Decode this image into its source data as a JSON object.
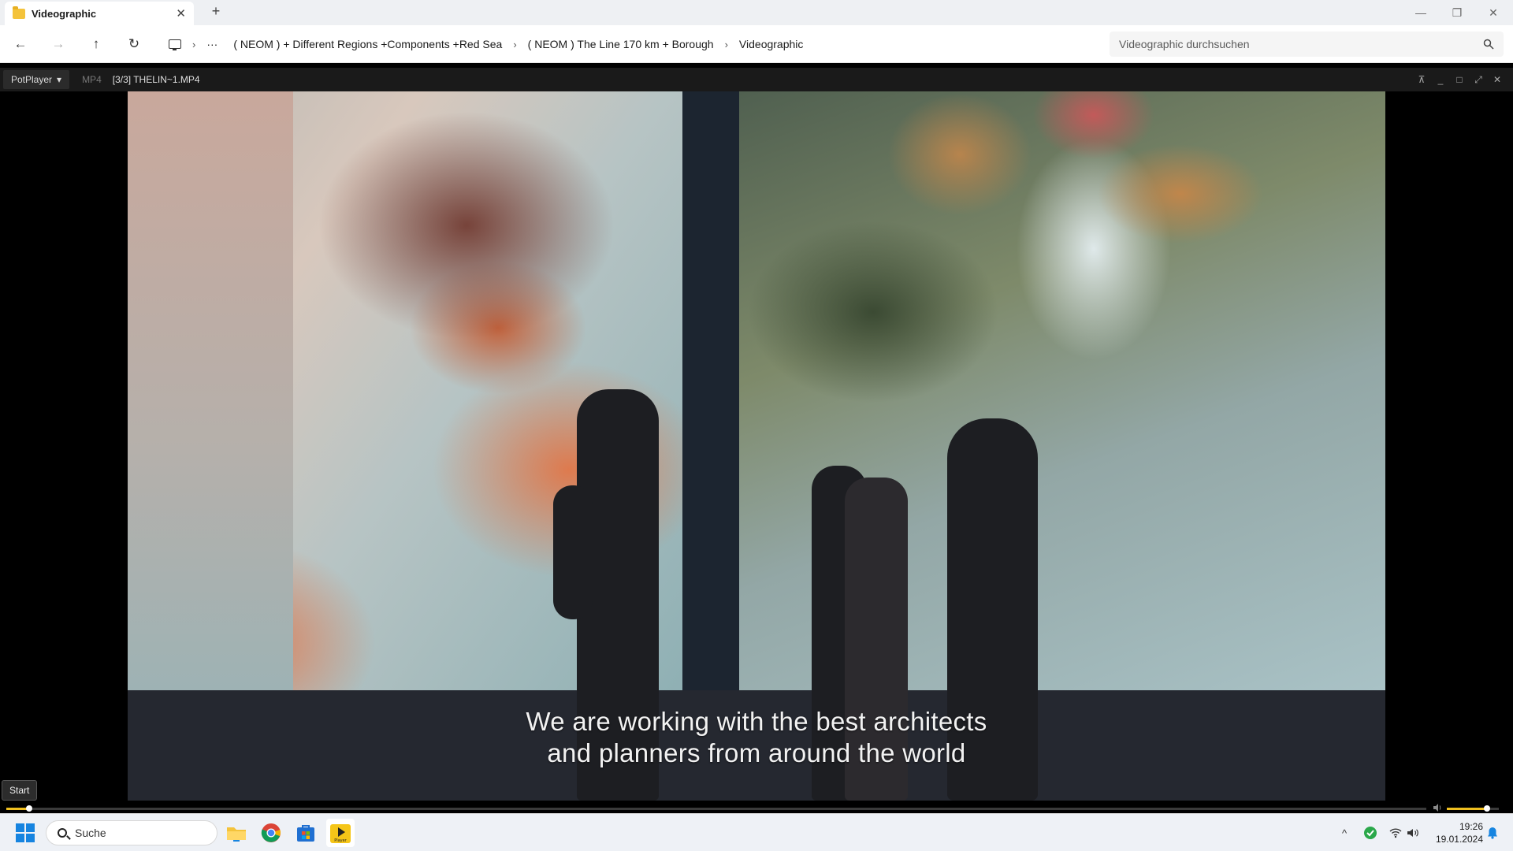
{
  "explorer": {
    "tab_title": "Videographic",
    "tab_close": "✕",
    "new_tab": "+",
    "window_controls": {
      "minimize": "—",
      "maximize": "❐",
      "close": "✕"
    },
    "nav": {
      "back": "←",
      "forward": "→",
      "up": "↑",
      "refresh": "↻"
    },
    "more": "···",
    "breadcrumbs": [
      "( NEOM ) + Different Regions +Components +Red Sea",
      "( NEOM ) The Line 170 km + Borough",
      "Videographic"
    ],
    "separator": "›",
    "search_placeholder": "Videographic durchsuchen",
    "search_icon": "search-icon"
  },
  "player": {
    "app_name": "PotPlayer",
    "menu_caret": "▾",
    "format": "MP4",
    "file_label": "[3/3] THELIN~1.MP4",
    "controls": {
      "pin": "⊼",
      "minimize": "_",
      "maximize": "□",
      "fullscreen": "⤢",
      "close": "✕"
    },
    "subtitle_line1": "We are working with the best architects",
    "subtitle_line2": "and planners from around the world",
    "seek_progress": 0.016,
    "volume_level": 0.78,
    "tooltip": "Start",
    "volume_icon": "speaker-icon"
  },
  "taskbar": {
    "search_label": "Suche",
    "pinned": [
      "file-explorer-icon",
      "chrome-icon",
      "store-icon",
      "potplayer-icon"
    ],
    "potplayer_label": "Player",
    "tray": {
      "chevron": "^",
      "wifi": "wifi-icon",
      "volume": "volume-icon",
      "bell": "notification-icon"
    },
    "time": "19:26",
    "date": "19.01.2024"
  },
  "colors": {
    "accent": "#f0c020",
    "player_bg": "#1a1a1a",
    "taskbar_bg": "#eef1f6",
    "windows_blue": "#1684e0"
  }
}
